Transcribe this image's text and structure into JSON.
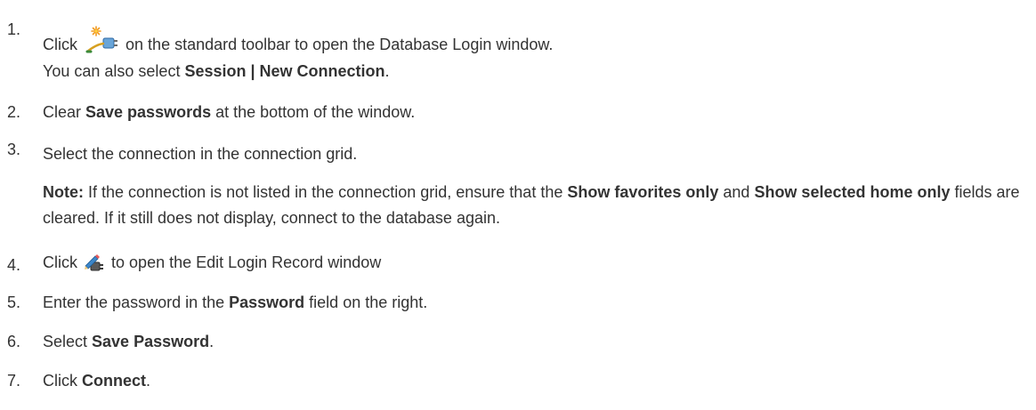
{
  "steps": [
    {
      "num": "1.",
      "pre": "Click",
      "icon": "new-connection-icon",
      "post": "on the standard toolbar to open the Database Login window.",
      "sub": {
        "pre": "You can also select ",
        "bold": "Session | New Connection",
        "post": "."
      }
    },
    {
      "num": "2.",
      "pre": "Clear ",
      "bold": "Save passwords",
      "post": " at the bottom of the window."
    },
    {
      "num": "3.",
      "text": "Select the connection in the connection grid.",
      "note": {
        "label": "Note:",
        "t1": " If the connection is not listed in the connection grid, ensure that the ",
        "b1": "Show favorites only",
        "t2": " and ",
        "b2": "Show selected home only",
        "t3": " fields are cleared. If it still does not display, connect to the database again."
      }
    },
    {
      "num": "4.",
      "pre": "Click",
      "icon": "edit-login-record-icon",
      "post": "to open the Edit Login Record window"
    },
    {
      "num": "5.",
      "pre": "Enter the password in the ",
      "bold": "Password",
      "post": " field on the right."
    },
    {
      "num": "6.",
      "pre": "Select ",
      "bold": "Save Password",
      "post": "."
    },
    {
      "num": "7.",
      "pre": "Click ",
      "bold": "Connect",
      "post": "."
    }
  ]
}
